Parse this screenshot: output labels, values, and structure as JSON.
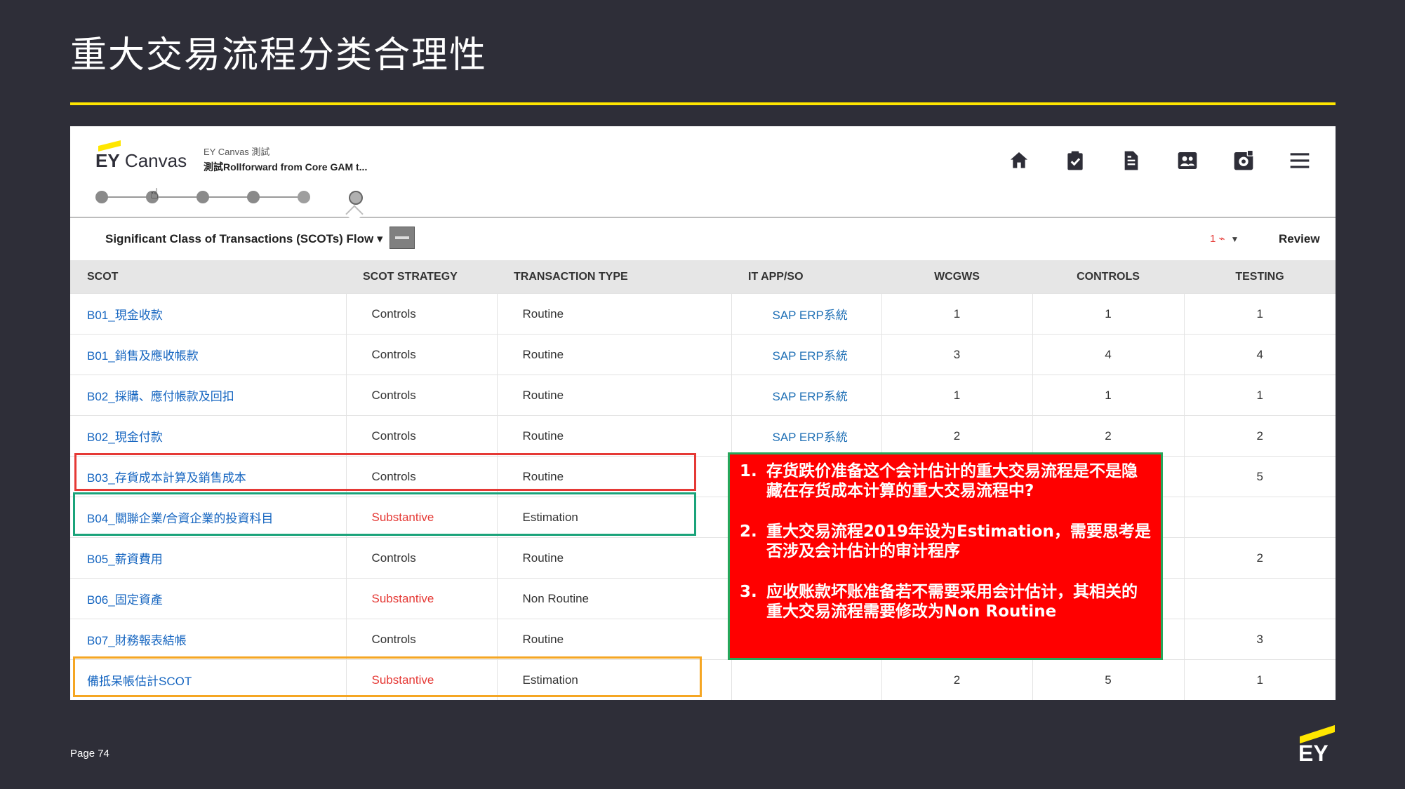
{
  "slide": {
    "title": "重大交易流程分类合理性",
    "page_label": "Page 74",
    "ey_logo_text": "EY"
  },
  "app": {
    "logo_text_bold": "EY",
    "logo_text": "Canvas",
    "engagement_line1": "EY Canvas 測試",
    "engagement_line2": "測試Rollforward from Core GAM t...",
    "nav_icons": [
      "home-icon",
      "clipboard-check-icon",
      "document-icon",
      "people-icon",
      "settings-gear-icon",
      "menu-icon"
    ]
  },
  "flow": {
    "title": "Significant Class of Transactions (SCOTs) Flow",
    "alert_count": "1",
    "review_label": "Review"
  },
  "table": {
    "headers": [
      "SCOT",
      "SCOT STRATEGY",
      "TRANSACTION TYPE",
      "IT APP/SO",
      "WCGWS",
      "CONTROLS",
      "TESTING"
    ],
    "rows": [
      {
        "scot": "B01_現金收款",
        "strategy": "Controls",
        "type": "Routine",
        "it": "SAP ERP系統",
        "wcgws": "1",
        "controls": "1",
        "testing": "1"
      },
      {
        "scot": "B01_銷售及應收帳款",
        "strategy": "Controls",
        "type": "Routine",
        "it": "SAP ERP系統",
        "wcgws": "3",
        "controls": "4",
        "testing": "4"
      },
      {
        "scot": "B02_採購、應付帳款及回扣",
        "strategy": "Controls",
        "type": "Routine",
        "it": "SAP ERP系統",
        "wcgws": "1",
        "controls": "1",
        "testing": "1"
      },
      {
        "scot": "B02_現金付款",
        "strategy": "Controls",
        "type": "Routine",
        "it": "SAP ERP系統",
        "wcgws": "2",
        "controls": "2",
        "testing": "2"
      },
      {
        "scot": "B03_存貨成本計算及銷售成本",
        "strategy": "Controls",
        "type": "Routine",
        "it": "",
        "wcgws": "",
        "controls": "",
        "testing": "5"
      },
      {
        "scot": "B04_關聯企業/合資企業的投資科目",
        "strategy": "Substantive",
        "type": "Estimation",
        "it": "",
        "wcgws": "",
        "controls": "",
        "testing": ""
      },
      {
        "scot": "B05_薪資費用",
        "strategy": "Controls",
        "type": "Routine",
        "it": "",
        "wcgws": "",
        "controls": "",
        "testing": "2"
      },
      {
        "scot": "B06_固定資產",
        "strategy": "Substantive",
        "type": "Non Routine",
        "it": "",
        "wcgws": "",
        "controls": "",
        "testing": ""
      },
      {
        "scot": "B07_財務報表結帳",
        "strategy": "Controls",
        "type": "Routine",
        "it": "",
        "wcgws": "",
        "controls": "",
        "testing": "3"
      },
      {
        "scot": "備抵呆帳估計SCOT",
        "strategy": "Substantive",
        "type": "Estimation",
        "it": "",
        "wcgws": "2",
        "controls": "5",
        "testing": "1"
      }
    ]
  },
  "callout": {
    "items": [
      {
        "num": "1.",
        "text": "存货跌价准备这个会计估计的重大交易流程是不是隐藏在存货成本计算的重大交易流程中?"
      },
      {
        "num": "2.",
        "text": "重大交易流程2019年设为Estimation，需要思考是否涉及会计估计的审计程序"
      },
      {
        "num": "3.",
        "text": "应收账款坏账准备若不需要采用会计估计，其相关的重大交易流程需要修改为Non Routine"
      }
    ]
  },
  "colors": {
    "slide_bg": "#2e2e38",
    "accent_yellow": "#ffe600",
    "link_blue": "#1565c0",
    "substantive_red": "#e53935",
    "callout_red": "#ff0000"
  }
}
